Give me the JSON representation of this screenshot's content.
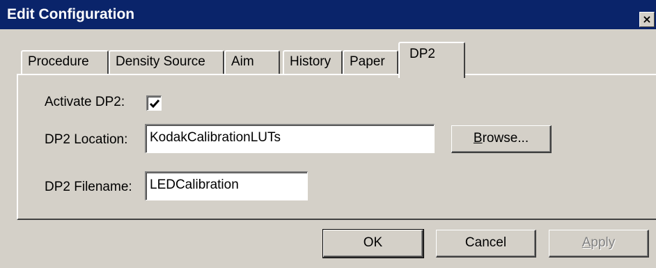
{
  "window": {
    "title": "Edit Configuration",
    "close_label": "×"
  },
  "tabs": [
    {
      "label": "Procedure",
      "active": false
    },
    {
      "label": "Density Source",
      "active": false
    },
    {
      "label": "Aim",
      "active": false
    },
    {
      "label": "History",
      "active": false
    },
    {
      "label": "Paper",
      "active": false
    },
    {
      "label": "DP2",
      "active": true
    }
  ],
  "dp2_panel": {
    "activate_label": "Activate DP2:",
    "activate_checked": true,
    "location_label": "DP2 Location:",
    "location_value": "KodakCalibrationLUTs",
    "browse_prefix": "",
    "browse_accel": "B",
    "browse_rest": "rowse...",
    "filename_label": "DP2 Filename:",
    "filename_value": "LEDCalibration"
  },
  "buttons": {
    "ok": "OK",
    "cancel": "Cancel",
    "apply_accel": "A",
    "apply_rest": "pply"
  }
}
